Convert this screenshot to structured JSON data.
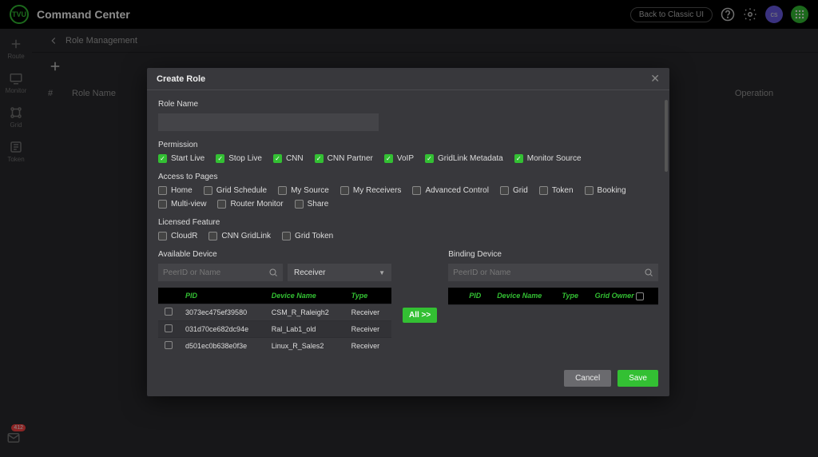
{
  "header": {
    "logo_text": "TVU",
    "title": "Command Center",
    "back_to_classic": "Back to Classic UI",
    "notif_badge": "412"
  },
  "sidebar": {
    "items": [
      {
        "label": "Route"
      },
      {
        "label": "Monitor"
      },
      {
        "label": "Grid"
      },
      {
        "label": "Token"
      }
    ]
  },
  "breadcrumb": {
    "title": "Role Management"
  },
  "table_headers": {
    "num": "#",
    "name": "Role Name",
    "operation": "Operation"
  },
  "modal": {
    "title": "Create Role",
    "role_name_label": "Role Name",
    "permission_label": "Permission",
    "permissions": [
      {
        "label": "Start Live",
        "checked": true
      },
      {
        "label": "Stop Live",
        "checked": true
      },
      {
        "label": "CNN",
        "checked": true
      },
      {
        "label": "CNN Partner",
        "checked": true
      },
      {
        "label": "VoIP",
        "checked": true
      },
      {
        "label": "GridLink Metadata",
        "checked": true
      },
      {
        "label": "Monitor Source",
        "checked": true
      }
    ],
    "access_label": "Access to Pages",
    "access_pages": [
      {
        "label": "Home",
        "checked": false
      },
      {
        "label": "Grid Schedule",
        "checked": false
      },
      {
        "label": "My Source",
        "checked": false
      },
      {
        "label": "My Receivers",
        "checked": false
      },
      {
        "label": "Advanced Control",
        "checked": false
      },
      {
        "label": "Grid",
        "checked": false
      },
      {
        "label": "Token",
        "checked": false
      },
      {
        "label": "Booking",
        "checked": false
      },
      {
        "label": "Multi-view",
        "checked": false
      },
      {
        "label": "Router Monitor",
        "checked": false
      },
      {
        "label": "Share",
        "checked": false
      }
    ],
    "licensed_label": "Licensed Feature",
    "licensed_features": [
      {
        "label": "CloudR",
        "checked": false
      },
      {
        "label": "CNN GridLink",
        "checked": false
      },
      {
        "label": "Grid Token",
        "checked": false
      }
    ],
    "available_label": "Available Device",
    "binding_label": "Binding Device",
    "search_placeholder": "PeerID or Name",
    "type_select": "Receiver",
    "all_button": "All >>",
    "available_columns": {
      "pid": "PID",
      "device_name": "Device Name",
      "type": "Type"
    },
    "binding_columns": {
      "pid": "PID",
      "device_name": "Device Name",
      "type": "Type",
      "grid_owner": "Grid Owner"
    },
    "available_rows": [
      {
        "pid": "3073ec475ef39580",
        "name": "CSM_R_Raleigh2",
        "type": "Receiver"
      },
      {
        "pid": "031d70ce682dc94e",
        "name": "Ral_Lab1_old",
        "type": "Receiver"
      },
      {
        "pid": "d501ec0b638e0f3e",
        "name": "Linux_R_Sales2",
        "type": "Receiver"
      }
    ],
    "cancel": "Cancel",
    "save": "Save"
  }
}
